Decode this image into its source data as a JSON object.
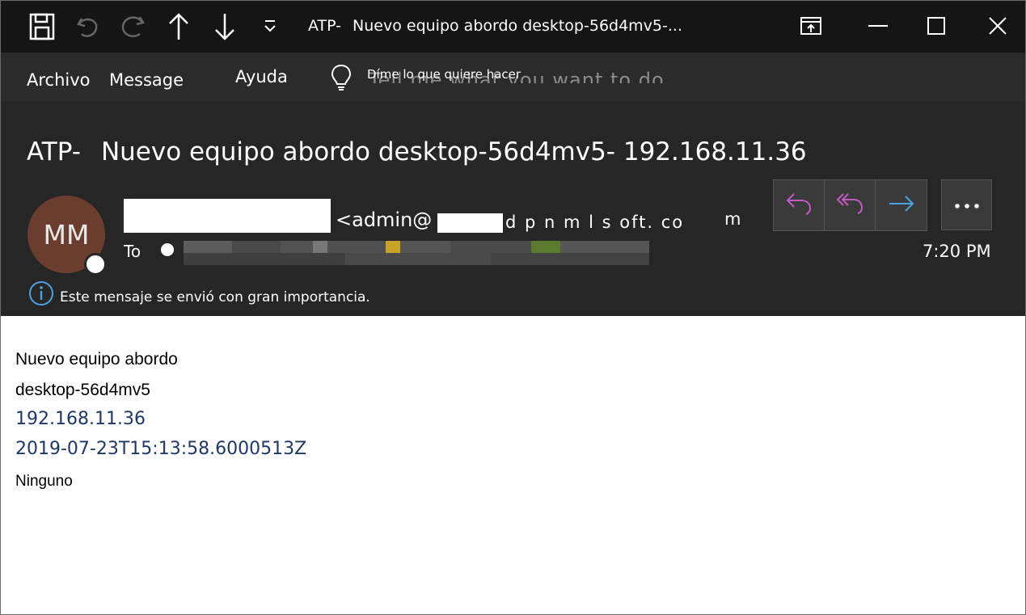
{
  "titlebar": {
    "title_prefix": "ATP-",
    "title": "Nuevo equipo abordo desktop-56d4mv5-..."
  },
  "menu": {
    "items": [
      "Archivo",
      "Message",
      "Ayuda"
    ],
    "tellme_label": "Díme lo que quiere hacer",
    "tellme_ghost": "Tell me what you want to do"
  },
  "message": {
    "subject_prefix": "ATP-",
    "subject": "Nuevo equipo abordo desktop-56d4mv5- 192.168.11.36",
    "avatar_initials": "MM",
    "sender_email_start": "<admin@",
    "sender_email_rest": "d p n m l s oft. co",
    "sender_trailing": "m",
    "to_label": "To",
    "time": "7:20 PM",
    "importance_notice": "Este mensaje se envió con gran importancia."
  },
  "actions": {
    "reply": "reply-icon",
    "reply_all": "reply-all-icon",
    "forward": "forward-icon",
    "more": "more-icon",
    "accent_color": "#c35bc3",
    "forward_color": "#4aa3df"
  },
  "body": {
    "line1": "Nuevo equipo abordo",
    "line2": "desktop-56d4mv5",
    "line3": "192.168.11.36",
    "line4": "2019-07-23T15:13:58.6000513Z",
    "line5": "Ninguno"
  }
}
